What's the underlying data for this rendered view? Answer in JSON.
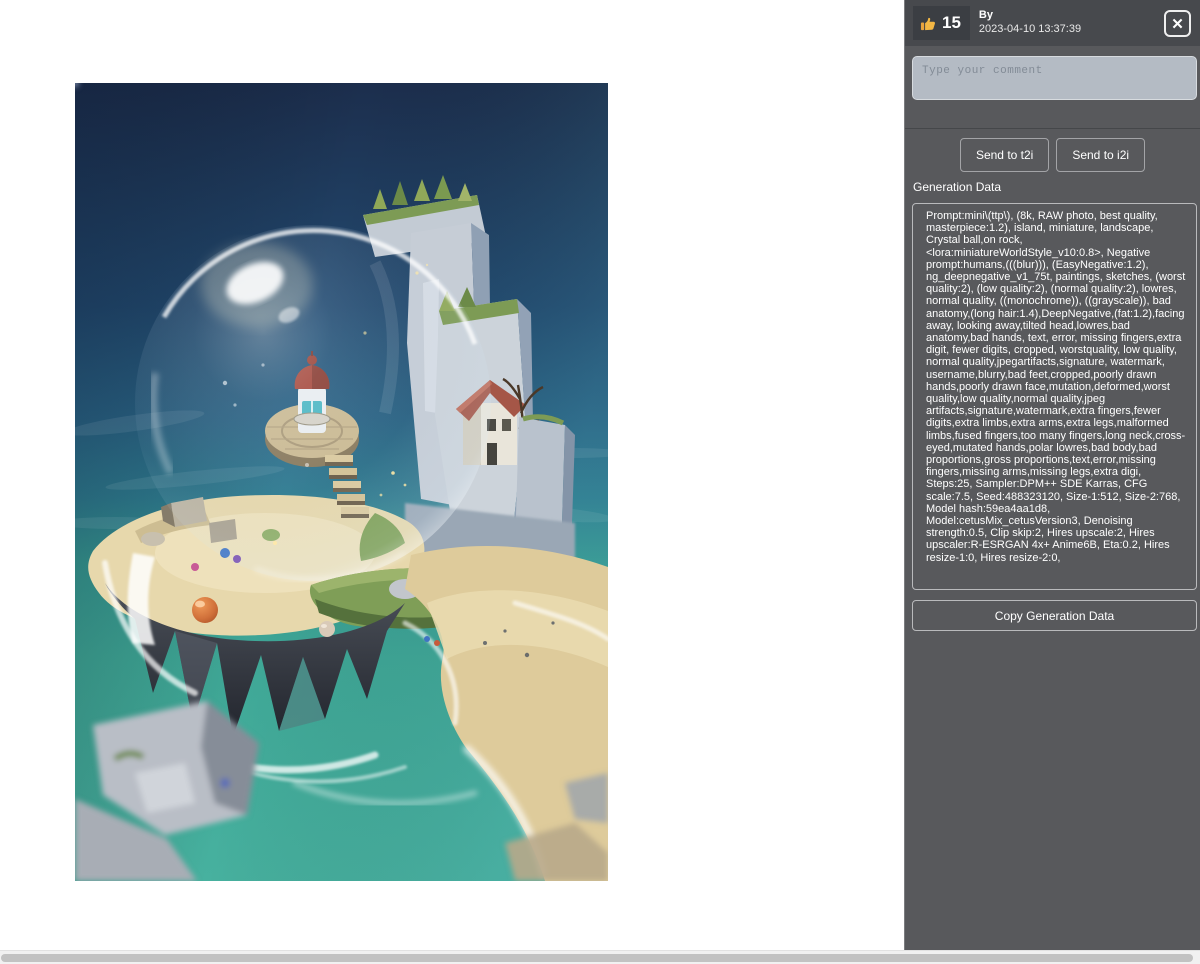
{
  "header": {
    "like_count": "15",
    "by_label": "By",
    "timestamp": "2023-04-10 13:37:39"
  },
  "icons": {
    "like_icon": "thumbs-up",
    "close_icon": "✕"
  },
  "comment": {
    "placeholder": "Type your comment"
  },
  "actions": {
    "send_t2i": "Send to t2i",
    "send_i2i": "Send to i2i"
  },
  "generation": {
    "label": "Generation Data",
    "text": "Prompt:mini\\(ttp\\), (8k, RAW photo, best quality, masterpiece:1.2), island, miniature, landscape, Crystal ball,on rock, <lora:miniatureWorldStyle_v10:0.8>, Negative prompt:humans,(((blur))), (EasyNegative:1.2), ng_deepnegative_v1_75t, paintings, sketches, (worst quality:2), (low quality:2), (normal quality:2), lowres, normal quality, ((monochrome)), ((grayscale)), bad anatomy,(long hair:1.4),DeepNegative,(fat:1.2),facing away, looking away,tilted head,lowres,bad anatomy,bad hands, text, error, missing fingers,extra digit, fewer digits, cropped, worstquality, low quality, normal quality,jpegartifacts,signature, watermark, username,blurry,bad feet,cropped,poorly drawn hands,poorly drawn face,mutation,deformed,worst quality,low quality,normal quality,jpeg artifacts,signature,watermark,extra fingers,fewer digits,extra limbs,extra arms,extra legs,malformed limbs,fused fingers,too many fingers,long neck,cross-eyed,mutated hands,polar lowres,bad body,bad proportions,gross proportions,text,error,missing fingers,missing arms,missing legs,extra digi, Steps:25, Sampler:DPM++ SDE Karras, CFG scale:7.5, Seed:488323120, Size-1:512, Size-2:768, Model hash:59ea4aa1d8, Model:cetusMix_cetusVersion3, Denoising strength:0.5, Clip skip:2, Hires upscale:2, Hires upscaler:R-ESRGAN 4x+ Anime6B, Eta:0.2, Hires resize-1:0, Hires resize-2:0,",
    "copy_button": "Copy Generation Data"
  },
  "colors": {
    "sidebar_bg": "#58595c",
    "header_bg": "#47494d",
    "comment_box_bg": "#b4bbc4",
    "scrollbar_thumb": "#c2c2c2"
  }
}
